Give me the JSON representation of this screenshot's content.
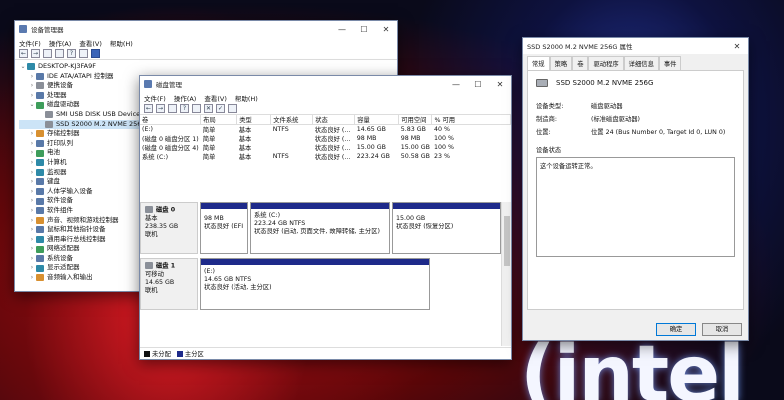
{
  "devmgr": {
    "title": "设备管理器",
    "menu": [
      "文件(F)",
      "操作(A)",
      "查看(V)",
      "帮助(H)"
    ],
    "root": "DESKTOP-KJ3FA9F",
    "items": [
      {
        "label": "IDE ATA/ATAPI 控制器",
        "indent": 1,
        "exp": "›"
      },
      {
        "label": "便携设备",
        "indent": 1,
        "exp": "›"
      },
      {
        "label": "处理器",
        "indent": 1,
        "exp": "›"
      },
      {
        "label": "磁盘驱动器",
        "indent": 1,
        "exp": "⌄"
      },
      {
        "label": "SMI USB DISK USB Device",
        "indent": 2,
        "exp": ""
      },
      {
        "label": "SSD S2000 M.2 NVME 256G",
        "indent": 2,
        "exp": ""
      },
      {
        "label": "存储控制器",
        "indent": 1,
        "exp": "›"
      },
      {
        "label": "打印队列",
        "indent": 1,
        "exp": "›"
      },
      {
        "label": "电池",
        "indent": 1,
        "exp": "›"
      },
      {
        "label": "计算机",
        "indent": 1,
        "exp": "›"
      },
      {
        "label": "监视器",
        "indent": 1,
        "exp": "›"
      },
      {
        "label": "键盘",
        "indent": 1,
        "exp": "›"
      },
      {
        "label": "人体学输入设备",
        "indent": 1,
        "exp": "›"
      },
      {
        "label": "软件设备",
        "indent": 1,
        "exp": "›"
      },
      {
        "label": "软件组件",
        "indent": 1,
        "exp": "›"
      },
      {
        "label": "声音、视频和游戏控制器",
        "indent": 1,
        "exp": "›"
      },
      {
        "label": "鼠标和其他指针设备",
        "indent": 1,
        "exp": "›"
      },
      {
        "label": "通用串行总线控制器",
        "indent": 1,
        "exp": "›"
      },
      {
        "label": "网络适配器",
        "indent": 1,
        "exp": "›"
      },
      {
        "label": "系统设备",
        "indent": 1,
        "exp": "›"
      },
      {
        "label": "显示适配器",
        "indent": 1,
        "exp": "›"
      },
      {
        "label": "音频输入和输出",
        "indent": 1,
        "exp": "›"
      }
    ]
  },
  "diskmgmt": {
    "title": "磁盘管理",
    "menu": [
      "文件(F)",
      "操作(A)",
      "查看(V)",
      "帮助(H)"
    ],
    "columns": [
      "卷",
      "布局",
      "类型",
      "文件系统",
      "状态",
      "容量",
      "可用空间",
      "% 可用"
    ],
    "rows": [
      [
        "(E:)",
        "简单",
        "基本",
        "NTFS",
        "状态良好 (...",
        "14.65 GB",
        "5.83 GB",
        "40 %"
      ],
      [
        "(磁盘 0 磁盘分区 1)",
        "简单",
        "基本",
        "",
        "状态良好 (...",
        "98 MB",
        "98 MB",
        "100 %"
      ],
      [
        "(磁盘 0 磁盘分区 4)",
        "简单",
        "基本",
        "",
        "状态良好 (...",
        "15.00 GB",
        "15.00 GB",
        "100 %"
      ],
      [
        "系统 (C:)",
        "简单",
        "基本",
        "NTFS",
        "状态良好 (...",
        "223.24 GB",
        "50.58 GB",
        "23 %"
      ]
    ],
    "disk0": {
      "name": "磁盘 0",
      "type": "基本",
      "size": "238.35 GB",
      "status": "联机",
      "p1": {
        "size": "98 MB",
        "status": "状态良好 (EFI 系"
      },
      "p2": {
        "name": "系统 (C:)",
        "size": "223.24 GB NTFS",
        "status": "状态良好 (启动, 页面文件, 故障转储, 主分区)"
      },
      "p3": {
        "size": "15.00 GB",
        "status": "状态良好 (恢复分区)"
      }
    },
    "disk1": {
      "name": "磁盘 1",
      "type": "可移动",
      "size": "14.65 GB",
      "status": "联机",
      "p1": {
        "name": "(E:)",
        "size": "14.65 GB NTFS",
        "status": "状态良好 (活动, 主分区)"
      }
    },
    "legend": [
      "未分配",
      "主分区"
    ]
  },
  "props": {
    "title": "SSD S2000 M.2 NVME 256G 属性",
    "tabs": [
      "常规",
      "策略",
      "卷",
      "驱动程序",
      "详细信息",
      "事件"
    ],
    "device_name": "SSD S2000 M.2  NVME 256G",
    "rows": [
      {
        "k": "设备类型:",
        "v": "磁盘驱动器"
      },
      {
        "k": "制造商:",
        "v": "(标准磁盘驱动器)"
      },
      {
        "k": "位置:",
        "v": "位置 24 (Bus Number 0, Target Id 0, LUN 0)"
      }
    ],
    "status_label": "设备状态",
    "status_text": "这个设备运转正常。",
    "ok": "确定",
    "cancel": "取消"
  },
  "wallpaper": {
    "logo": "(intel"
  },
  "colors": {
    "primary_partition": "#1e2a8a",
    "unallocated": "#111111",
    "accent": "#0078d7"
  }
}
